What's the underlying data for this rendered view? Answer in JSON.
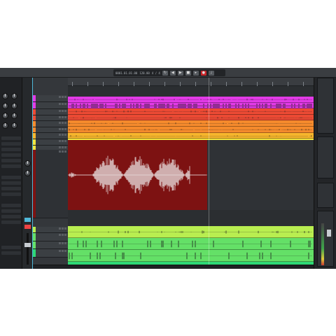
{
  "transport": {
    "position": "0001.01.01.00",
    "tempo": "120.00",
    "signature": "4 / 4",
    "buttons": [
      "loop",
      "rewind",
      "forward",
      "stop",
      "play",
      "record",
      "metronome"
    ]
  },
  "colors": {
    "magenta": "#e23ae6",
    "red_orange": "#ec4a34",
    "orange": "#f58a2c",
    "amber": "#f7b62c",
    "yellow": "#f2e640",
    "dark_red": "#7d1212",
    "lime": "#b9ee50",
    "green": "#64e067",
    "teal_green": "#2ed876",
    "accent": "#4fb8d8"
  },
  "tracks": [
    {
      "color": "magenta"
    },
    {
      "color": "magenta"
    },
    {
      "color": "red_orange"
    },
    {
      "color": "red_orange"
    },
    {
      "color": "orange"
    },
    {
      "color": "orange"
    },
    {
      "color": "amber"
    },
    {
      "color": "yellow"
    },
    {
      "color": "yellow"
    },
    {
      "color": "yellow"
    },
    {
      "color": "dark_red"
    },
    {
      "color": "lime"
    },
    {
      "color": "green"
    },
    {
      "color": "green"
    },
    {
      "color": "teal_green"
    }
  ],
  "icons": [
    "loop-icon",
    "rewind-icon",
    "forward-icon",
    "stop-icon",
    "play-icon",
    "record-icon",
    "metronome-icon"
  ]
}
